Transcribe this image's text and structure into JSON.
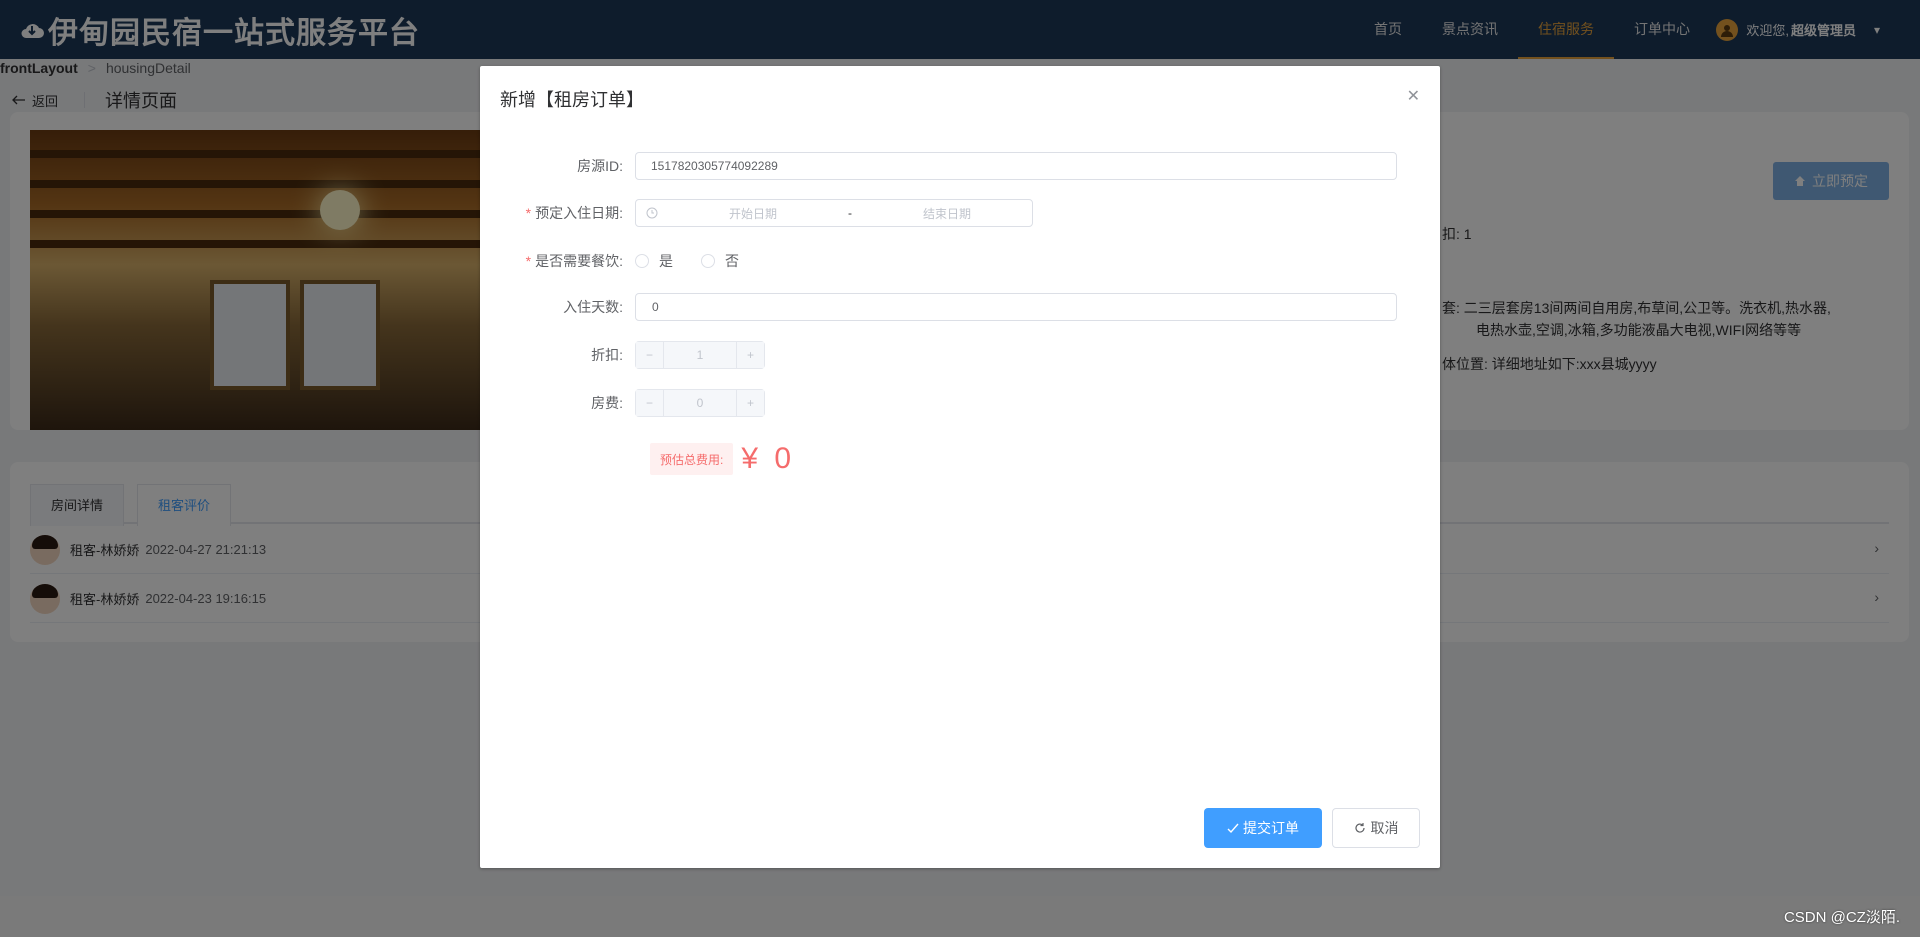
{
  "header": {
    "brand": "伊甸园民宿一站式服务平台",
    "nav": [
      "首页",
      "景点资讯",
      "住宿服务",
      "订单中心"
    ],
    "active_nav": "住宿服务",
    "welcome": "欢迎您,",
    "username": "超级管理员"
  },
  "breadcrumb": {
    "root": "frontLayout",
    "current": "housingDetail"
  },
  "page_header": {
    "back": "返回",
    "title": "详情页面"
  },
  "detail": {
    "book_button": "立即预定",
    "discount_line": "扣: 1",
    "facilities_line1": "套: 二三层套房13间两间自用房,布草间,公卫等。洗衣机,热水器,",
    "facilities_line2": "电热水壶,空调,冰箱,多功能液晶大电视,WIFI网络等等",
    "location_line": "体位置: 详细地址如下:xxx县城yyyy"
  },
  "tabs": [
    "房间详情",
    "租客评价"
  ],
  "active_tab": "租客评价",
  "reviews": [
    {
      "name": "租客-林娇娇",
      "time": "2022-04-27 21:21:13"
    },
    {
      "name": "租客-林娇娇",
      "time": "2022-04-23 19:16:15"
    }
  ],
  "dialog": {
    "title": "新增【租房订单】",
    "fields": {
      "house_id_label": "房源ID:",
      "house_id_value": "1517820305774092289",
      "dates_label": "预定入住日期:",
      "start_placeholder": "开始日期",
      "end_placeholder": "结束日期",
      "date_sep": "-",
      "meal_label": "是否需要餐饮:",
      "meal_yes": "是",
      "meal_no": "否",
      "days_label": "入住天数:",
      "days_value": "0",
      "discount_label": "折扣:",
      "discount_value": "1",
      "fee_label": "房费:",
      "fee_value": "0"
    },
    "total_label": "预估总费用:",
    "total_amount": "¥ 0",
    "submit": "提交订单",
    "cancel": "取消"
  },
  "watermark": "CSDN @CZ淡陌."
}
